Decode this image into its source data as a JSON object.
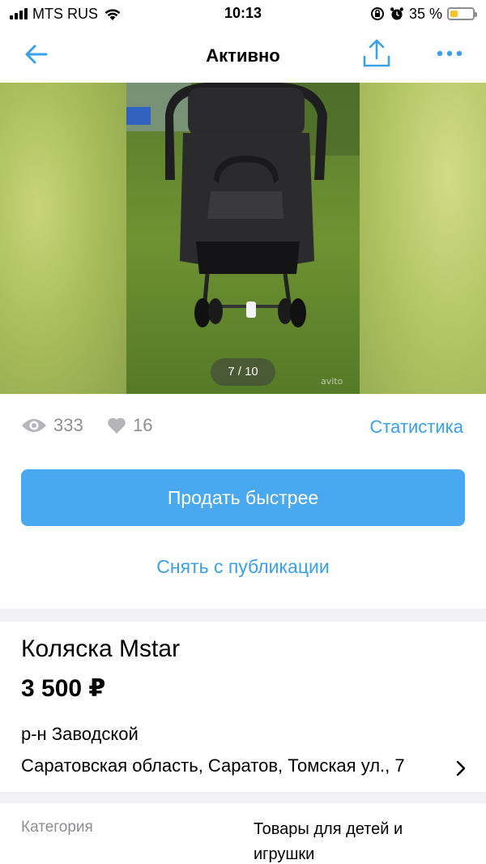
{
  "status_bar": {
    "carrier": "MTS RUS",
    "time": "10:13",
    "battery_percent": "35 %",
    "battery_level": 0.35
  },
  "nav": {
    "title": "Активно",
    "back_icon": "arrow-left-icon",
    "share_icon": "share-icon",
    "more_icon": "more-icon"
  },
  "gallery": {
    "counter": "7 / 10",
    "watermark": "avito"
  },
  "stats": {
    "views": "333",
    "likes": "16",
    "link": "Статистика"
  },
  "actions": {
    "sell_faster": "Продать быстрее",
    "unpublish": "Снять с публикации"
  },
  "listing": {
    "title": "Коляска Mstar",
    "price": "3 500 ₽",
    "district": "р-н Заводской",
    "address": "Саратовская область, Саратов, Томская ул., 7"
  },
  "details": {
    "category_label": "Категория",
    "category_value": "Товары для детей и игрушки"
  },
  "colors": {
    "accent": "#3aa0e8",
    "button": "#4aa8f0",
    "muted": "#8e8e93",
    "battery": "#f7c325"
  }
}
